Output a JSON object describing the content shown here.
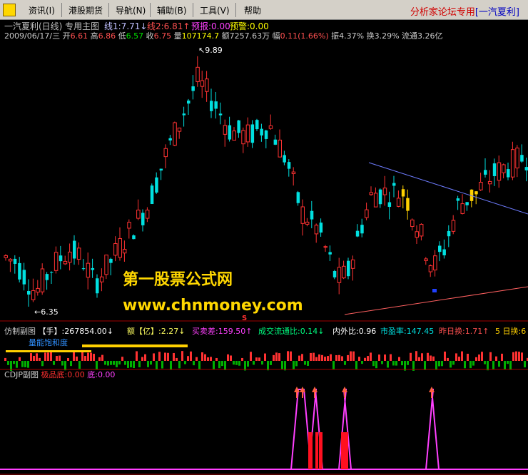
{
  "menu": {
    "icon": "app-icon",
    "items": [
      "资讯(I)",
      "港股期货",
      "导航(N)",
      "辅助(B)",
      "工具(V)",
      "帮助"
    ],
    "promo_prefix": "分析家论坛专用",
    "promo_suffix": "[一汽夏利]"
  },
  "main_panel": {
    "title": "一汽夏利(日线) 专用主图",
    "line1": "线1:7.71↓",
    "line2": "线2:6.81↑",
    "forecast": "预报:0.00",
    "warning": "预警:0.00",
    "date": "2009/06/17/三",
    "open_label": "开",
    "open": "6.61",
    "high_label": "高",
    "high": "6.86",
    "low_label": "低",
    "low": "6.57",
    "close_label": "收",
    "close": "6.75",
    "vol_label": "量",
    "vol": "107174.7",
    "amt_label": "额",
    "amt": "7257.63万",
    "chg_label": "幅",
    "chg": "0.11(1.66%)",
    "amp": "振4.37%",
    "turnover": "换3.29%",
    "float": "流通3.26亿",
    "high_marker": "9.89",
    "low_marker": "6.35",
    "s_marker": "S"
  },
  "watermark": {
    "line1": "第一股票公式网",
    "line2": "www.chnmoney.com"
  },
  "sub_panel1": {
    "title": "仿制副图",
    "hand": "【手】:267854.00↓",
    "amount": "额【亿】:2.27↓",
    "buy_sell": "买卖差:159.50↑",
    "ratio": "成交流通比:0.14↓",
    "inout": "内外比:0.96",
    "pe": "市盈率:147.45",
    "prev_turn": "昨日换:1.71↑",
    "five_turn": "5 日换:6",
    "overlay": "量能饱和度"
  },
  "sub_panel2": {
    "title": "CDJP副图",
    "extreme": "极品底:0.00",
    "bottom": "底:0.00"
  },
  "colors": {
    "up": "#ff3232",
    "down": "#00e0e0",
    "yellow": "#ffd000",
    "magenta": "#ff40ff",
    "trend_blue": "#6e7cff",
    "trend_red": "#ff6060",
    "green_vol": "#00b000"
  },
  "price_range": [
    6.0,
    10.1
  ]
}
